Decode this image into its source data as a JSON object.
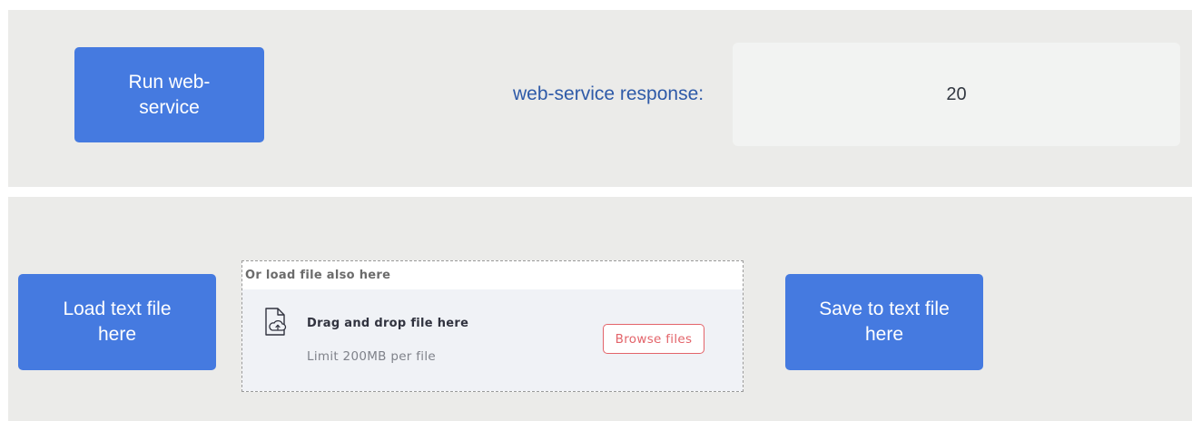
{
  "top_panel": {
    "run_button_label": "Run web-service",
    "response_label": "web-service response:",
    "response_value": "20"
  },
  "bottom_panel": {
    "load_button_label": "Load text file here",
    "save_button_label": "Save to text file here",
    "uploader": {
      "label": "Or load file also here",
      "drop_title": "Drag and drop file here",
      "limit_text": "Limit 200MB per file",
      "browse_label": "Browse files",
      "icon": "file-upload-icon"
    }
  },
  "colors": {
    "panel_background": "#ebebe9",
    "primary_button": "#457ae0",
    "response_label": "#2e5aa8",
    "browse_accent": "#e3646a"
  }
}
